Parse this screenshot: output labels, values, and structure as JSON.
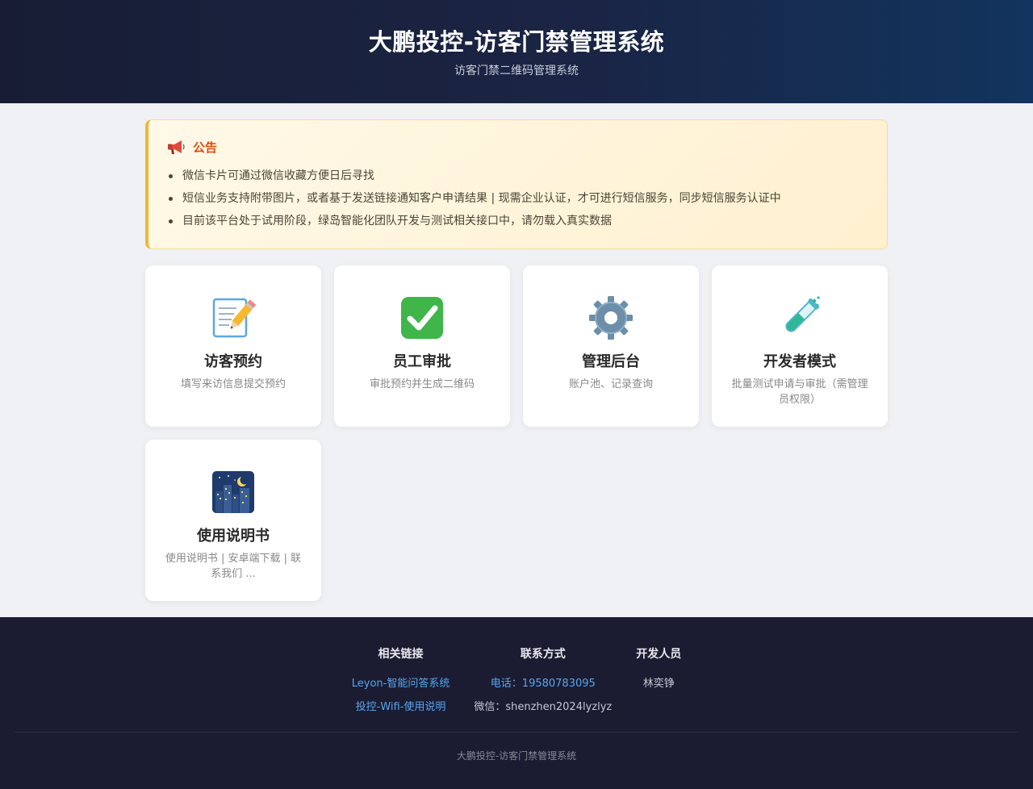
{
  "header": {
    "title": "大鹏投控-访客门禁管理系统",
    "subtitle": "访客门禁二维码管理系统"
  },
  "notice": {
    "icon": "megaphone-icon",
    "title": "公告",
    "items": [
      "微信卡片可通过微信收藏方便日后寻找",
      "短信业务支持附带图片，或者基于发送链接通知客户申请结果 | 现需企业认证，才可进行短信服务，同步短信服务认证中",
      "目前该平台处于试用阶段，绿岛智能化团队开发与测试相关接口中，请勿载入真实数据"
    ]
  },
  "cards": [
    {
      "icon": "memo-pencil-icon",
      "title": "访客预约",
      "desc": "填写来访信息提交预约"
    },
    {
      "icon": "check-mark-icon",
      "title": "员工审批",
      "desc": "审批预约并生成二维码"
    },
    {
      "icon": "gear-icon",
      "title": "管理后台",
      "desc": "账户池、记录查询"
    },
    {
      "icon": "test-tube-icon",
      "title": "开发者模式",
      "desc": "批量测试申请与审批（需管理员权限）"
    },
    {
      "icon": "night-city-icon",
      "title": "使用说明书",
      "desc": "使用说明书 | 安卓端下载 | 联系我们 ..."
    }
  ],
  "footer": {
    "links_title": "相关链接",
    "links": [
      "Leyon-智能问答系统",
      "投控-Wifi-使用说明"
    ],
    "contact_title": "联系方式",
    "phone": "电话：19580783095",
    "wechat": "微信：shenzhen2024lyzlyz",
    "dev_title": "开发人员",
    "dev_name": "林奕铮",
    "copyright": "大鹏投控-访客门禁管理系统"
  },
  "colors": {
    "header_bg": "#181d35",
    "notice_accent": "#f2b630",
    "notice_title": "#d9500f",
    "footer_bg": "#1b1c32",
    "link": "#57a6ee"
  }
}
